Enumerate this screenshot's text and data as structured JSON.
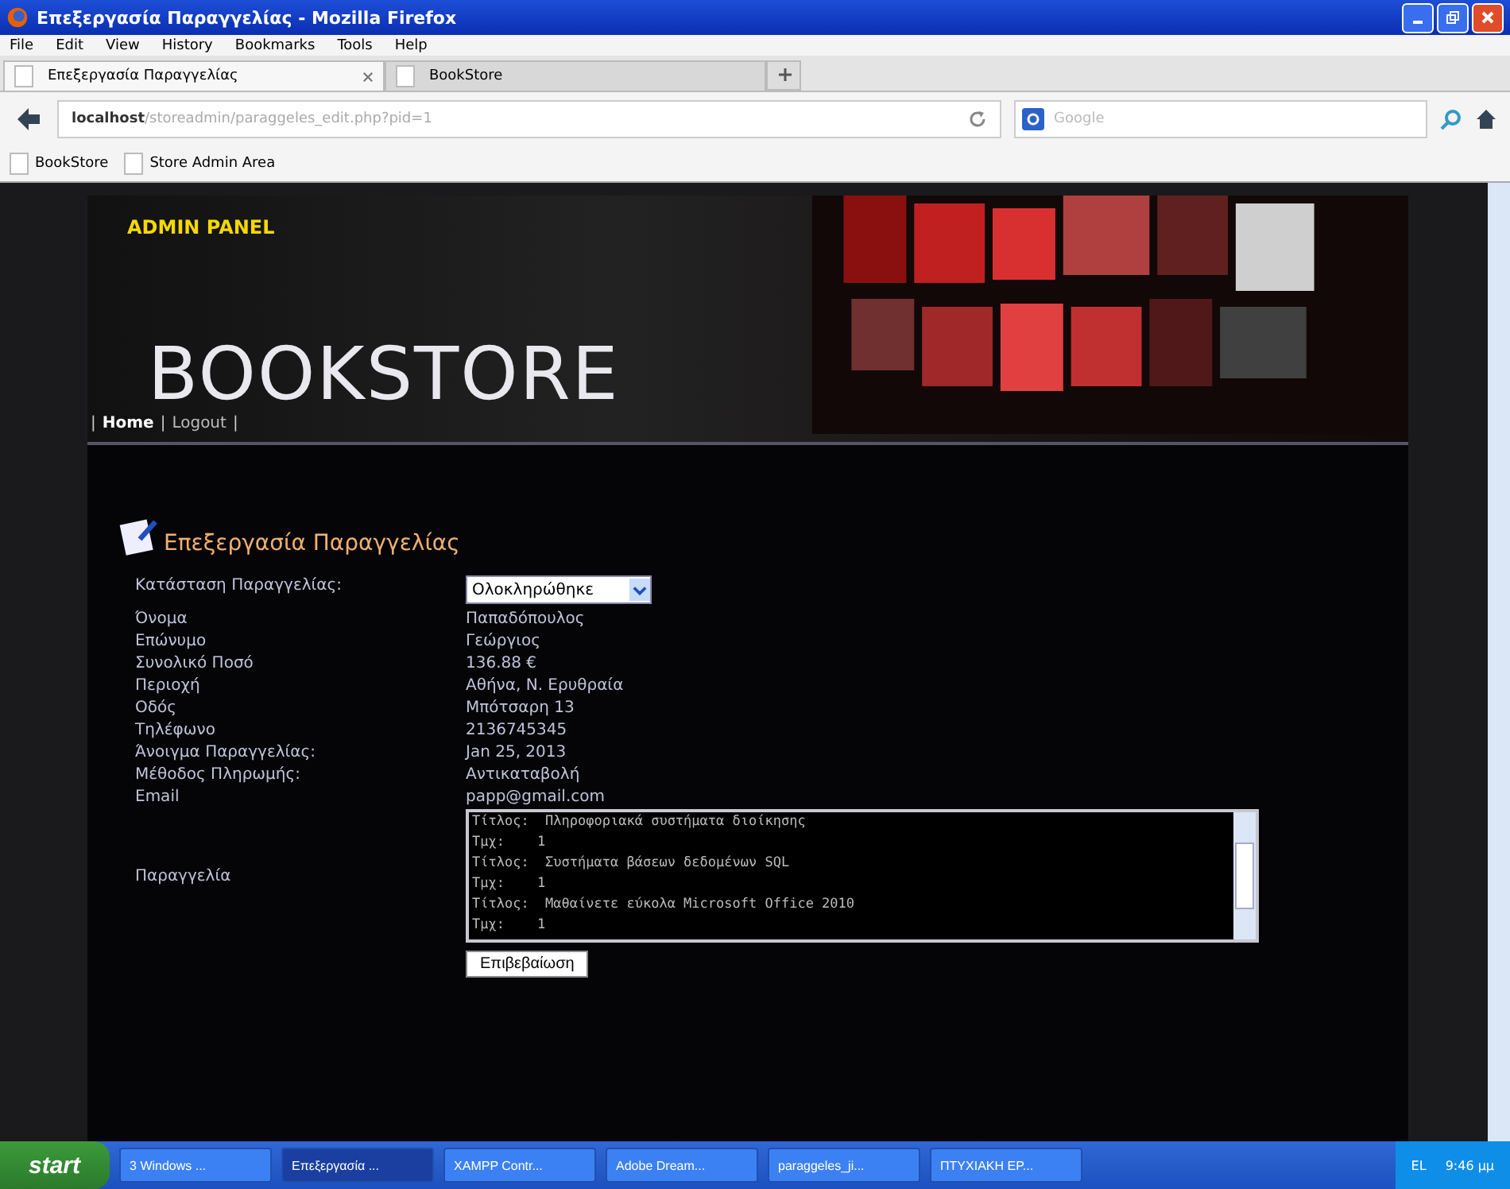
{
  "window": {
    "title": "Επεξεργασία Παραγγελίας - Mozilla Firefox"
  },
  "menu": [
    "File",
    "Edit",
    "View",
    "History",
    "Bookmarks",
    "Tools",
    "Help"
  ],
  "tabs": [
    {
      "label": "Επεξεργασία Παραγγελίας",
      "selected": true
    },
    {
      "label": "BookStore",
      "selected": false
    }
  ],
  "address": {
    "host": "localhost",
    "path": "/storeadmin/paraggeles_edit.php?pid=1"
  },
  "search": {
    "placeholder": "Google"
  },
  "bookmarks": [
    "BookStore",
    "Store Admin Area"
  ],
  "header": {
    "badge": "ADMIN PANEL",
    "title": "BOOKSTORE"
  },
  "nav": [
    {
      "kind": "sep",
      "text": "|"
    },
    {
      "kind": "link",
      "text": "Home",
      "selected": true
    },
    {
      "kind": "sep",
      "text": "|"
    },
    {
      "kind": "link",
      "text": "Logout",
      "selected": false
    },
    {
      "kind": "sep",
      "text": "|"
    }
  ],
  "heading": "Επεξεργασία Παραγγελίας",
  "status": {
    "label": "Κατάσταση Παραγγελίας:",
    "value": "Ολοκληρώθηκε"
  },
  "fields": [
    {
      "label": "Όνομα",
      "value": "Παπαδόπουλος"
    },
    {
      "label": "Επώνυμο",
      "value": "Γεώργιος"
    },
    {
      "label": "Συνολικό Ποσό",
      "value": "136.88 €"
    },
    {
      "label": "Περιοχή",
      "value": "Αθήνα, Ν. Ερυθραία"
    },
    {
      "label": "Οδός",
      "value": "Μπότσαρη 13"
    },
    {
      "label": "Τηλέφωνο",
      "value": "2136745345"
    },
    {
      "label": "Άνοιγμα Παραγγελίας:",
      "value": "Jan 25, 2013"
    },
    {
      "label": "Μέθοδος Πληρωμής:",
      "value": "Αντικαταβολή"
    },
    {
      "label": "Email",
      "value": "papp@gmail.com"
    }
  ],
  "order": {
    "label": "Παραγγελία",
    "lines": [
      "Τίτλος:  Πληροφοριακά συστήματα διοίκησης",
      "Τμχ:    1",
      "Τίτλος:  Συστήματα βάσεων δεδομένων SQL",
      "Τμχ:    1",
      "Τίτλος:  Μαθαίνετε εύκολα Microsoft Office 2010",
      "Τμχ:    1"
    ]
  },
  "submit": "Επιβεβαίωση",
  "taskbar": {
    "start": "start",
    "items": [
      {
        "label": "3 Windows ...",
        "selected": false
      },
      {
        "label": "Επεξεργασία ...",
        "selected": true
      },
      {
        "label": "XAMPP Contr...",
        "selected": false
      },
      {
        "label": "Adobe Dream...",
        "selected": false
      },
      {
        "label": "paraggeles_ji...",
        "selected": false
      },
      {
        "label": "ΠΤΥΧΙΑΚΗ ΕΡ...",
        "selected": false
      }
    ],
    "lang": "EL",
    "clock": "9:46 μμ"
  }
}
